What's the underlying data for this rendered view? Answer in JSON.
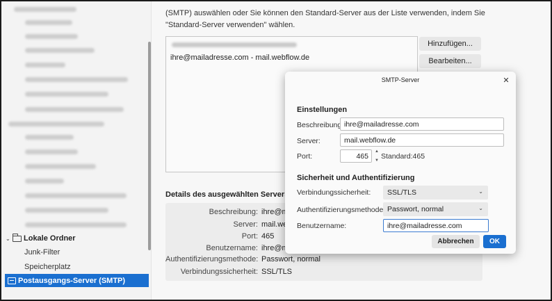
{
  "sidebar": {
    "local_folders": "Lokale Ordner",
    "items": [
      "Junk-Filter",
      "Speicherplatz"
    ],
    "selected": "Postausgangs-Server (SMTP)"
  },
  "main": {
    "intro_lines": [
      "(SMTP) auswählen oder Sie können den Standard-Server aus der Liste verwenden, indem Sie",
      "\"Standard-Server verwenden\" wählen."
    ],
    "server_entry": "ihre@mailadresse.com - mail.webflow.de",
    "add_button": "Hinzufügen...",
    "edit_button": "Bearbeiten...",
    "details_title": "Details des ausgewählten Servers",
    "details": [
      {
        "label": "Beschreibung:",
        "value": "ihre@m"
      },
      {
        "label": "Server:",
        "value": "mail.web"
      },
      {
        "label": "Port:",
        "value": "465"
      },
      {
        "label": "Benutzername:",
        "value": "ihre@m"
      },
      {
        "label": "Authentifizierungsmethode:",
        "value": "Passwort, normal"
      },
      {
        "label": "Verbindungssicherheit:",
        "value": "SSL/TLS"
      }
    ]
  },
  "dialog": {
    "title": "SMTP-Server",
    "settings_heading": "Einstellungen",
    "description_label": "Beschreibung:",
    "description_value": "ihre@mailadresse.com",
    "server_label": "Server:",
    "server_value": "mail.webflow.de",
    "port_label": "Port:",
    "port_value": "465",
    "port_default": "Standard:465",
    "security_heading": "Sicherheit und Authentifizierung",
    "connection_security_label": "Verbindungssicherheit:",
    "connection_security_value": "SSL/TLS",
    "auth_method_label": "Authentifizierungsmethode:",
    "auth_method_value": "Passwort, normal",
    "username_label": "Benutzername:",
    "username_value": "ihre@mailadresse.com",
    "cancel_button": "Abbrechen",
    "ok_button": "OK"
  },
  "colors": {
    "accent": "#1a6fd0"
  },
  "icons": {
    "close": "close-icon",
    "folder": "folder-icon",
    "server": "server-icon",
    "dropdown": "chevron-down-icon"
  }
}
